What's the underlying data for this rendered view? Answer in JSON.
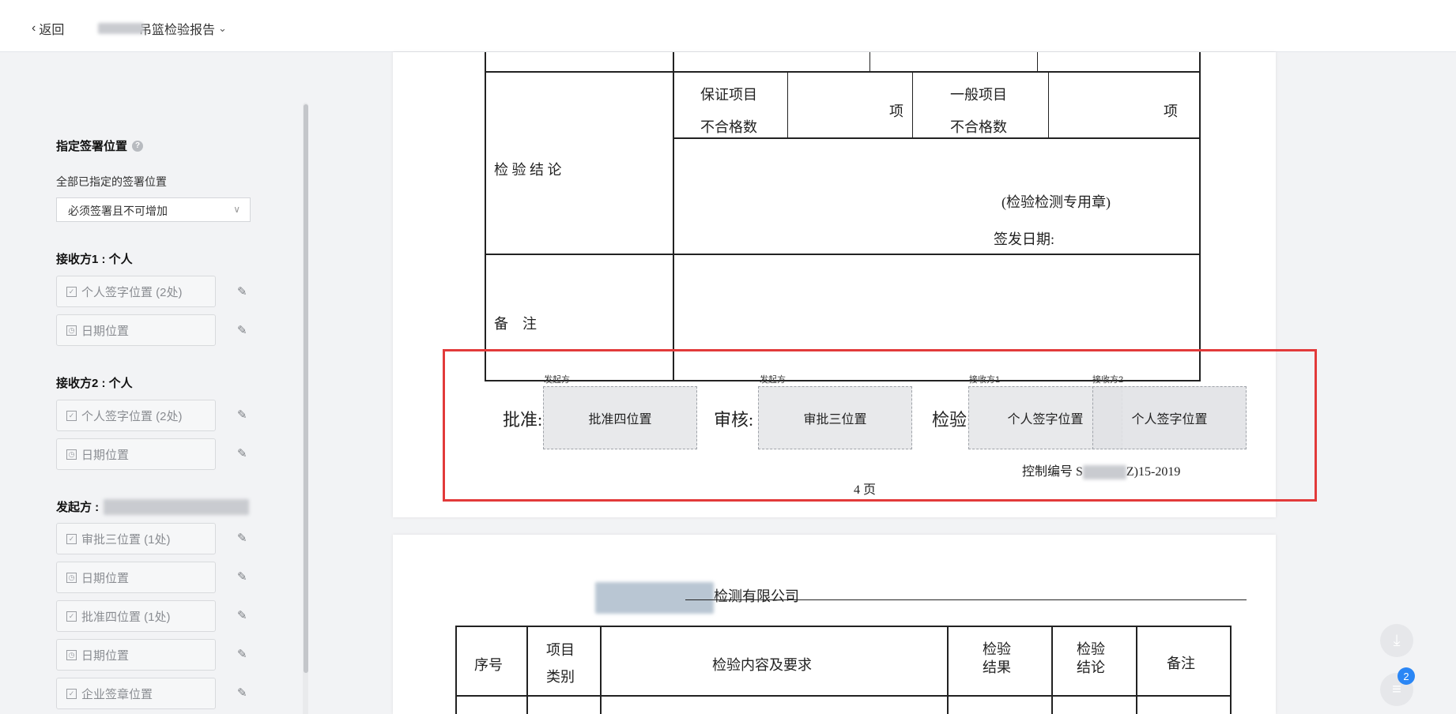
{
  "topbar": {
    "back_label": "返回",
    "doc_title": "吊篮检验报告"
  },
  "sidebar": {
    "section_title": "指定签署位置",
    "all_positions_label": "全部已指定的签署位置",
    "select_value": "必须签署且不可增加",
    "groups": [
      {
        "title": "接收方1 : 个人",
        "items": [
          {
            "label": "个人签字位置 (2处)",
            "icon": "checkbox-sign-icon"
          },
          {
            "label": "日期位置",
            "icon": "date-icon"
          }
        ]
      },
      {
        "title": "接收方2 : 个人",
        "items": [
          {
            "label": "个人签字位置 (2处)",
            "icon": "checkbox-sign-icon"
          },
          {
            "label": "日期位置",
            "icon": "date-icon"
          }
        ]
      },
      {
        "title": "发起方 :",
        "items": [
          {
            "label": "审批三位置 (1处)",
            "icon": "checkbox-sign-icon"
          },
          {
            "label": "日期位置",
            "icon": "date-icon"
          },
          {
            "label": "批准四位置 (1处)",
            "icon": "checkbox-sign-icon"
          },
          {
            "label": "日期位置",
            "icon": "date-icon"
          },
          {
            "label": "企业签章位置",
            "icon": "checkbox-sign-icon"
          }
        ]
      }
    ]
  },
  "page1": {
    "guarantee_label_1": "保证项目",
    "guarantee_label_2": "不合格数",
    "unit_1": "项",
    "general_label_1": "一般项目",
    "general_label_2": "不合格数",
    "unit_2": "项",
    "conclusion_label": "检 验 结 论",
    "stamp_text": "(检验检测专用章)",
    "issue_date_label": "签发日期:",
    "remarks_label": "备　注",
    "approve_label": "批准:",
    "review_label": "审核:",
    "inspect_label": "检验:",
    "sig_tag_initiator_1": "发起方",
    "sig_tag_initiator_2": "发起方",
    "sig_tag_receiver_1": "接收方1",
    "sig_tag_receiver_2": "接收方2",
    "sig_box_approve": "批准四位置",
    "sig_box_review": "审批三位置",
    "sig_box_personal_1": "个人签字位置",
    "sig_box_personal_2": "个人签字位置",
    "control_no_prefix": "控制编号 S",
    "control_no_suffix": "Z)15-2019",
    "page_no": "4 页"
  },
  "page2": {
    "company_suffix": "检测有限公司",
    "headers": [
      "序号",
      "项目类别",
      "检验内容及要求",
      "检验结果",
      "检验结论",
      "备注"
    ]
  },
  "fabs": {
    "download_icon": "download-icon",
    "list_icon": "list-icon",
    "badge_count": "2"
  }
}
